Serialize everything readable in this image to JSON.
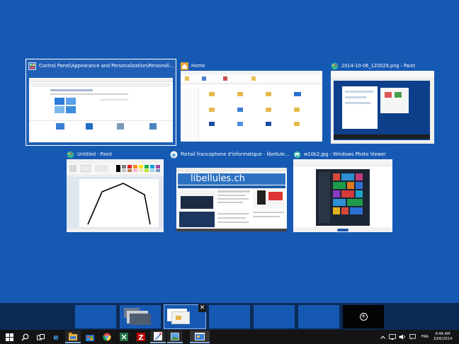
{
  "windows": [
    {
      "title": "Control Panel\\Appearance and Personalization\\Personalization",
      "icon": "control-panel-icon",
      "selected": true
    },
    {
      "title": "Home",
      "icon": "home-icon"
    },
    {
      "title": "2014-10-06_120029.png - Paint",
      "icon": "paint-icon"
    },
    {
      "title": "Untitled - Paint",
      "icon": "paint-icon"
    },
    {
      "title": "Portail francophone d'informatique - libellules.ch ...",
      "icon": "internet-explorer-icon"
    },
    {
      "title": "w10b2.jpg - Windows Photo Viewer",
      "icon": "photo-viewer-icon"
    }
  ],
  "libellules_logo": "libellules.ch",
  "desktops": {
    "count": 7,
    "active_index": 3,
    "close_glyph": "✕",
    "add_glyph": "+"
  },
  "taskbar": {
    "apps": [
      "start-icon",
      "search-icon",
      "task-view-icon",
      "internet-explorer-icon",
      "file-explorer-icon",
      "store-icon",
      "chrome-icon",
      "excel-icon",
      "filezilla-icon",
      "paint-icon",
      "photo-viewer-icon"
    ]
  },
  "tray": {
    "language": "FRA",
    "time": "4:49 AM",
    "date": "10/6/2014"
  },
  "colors": {
    "background": "#1659b3",
    "desktops_bar": "#0b2a55",
    "taskbar": "#141414"
  }
}
